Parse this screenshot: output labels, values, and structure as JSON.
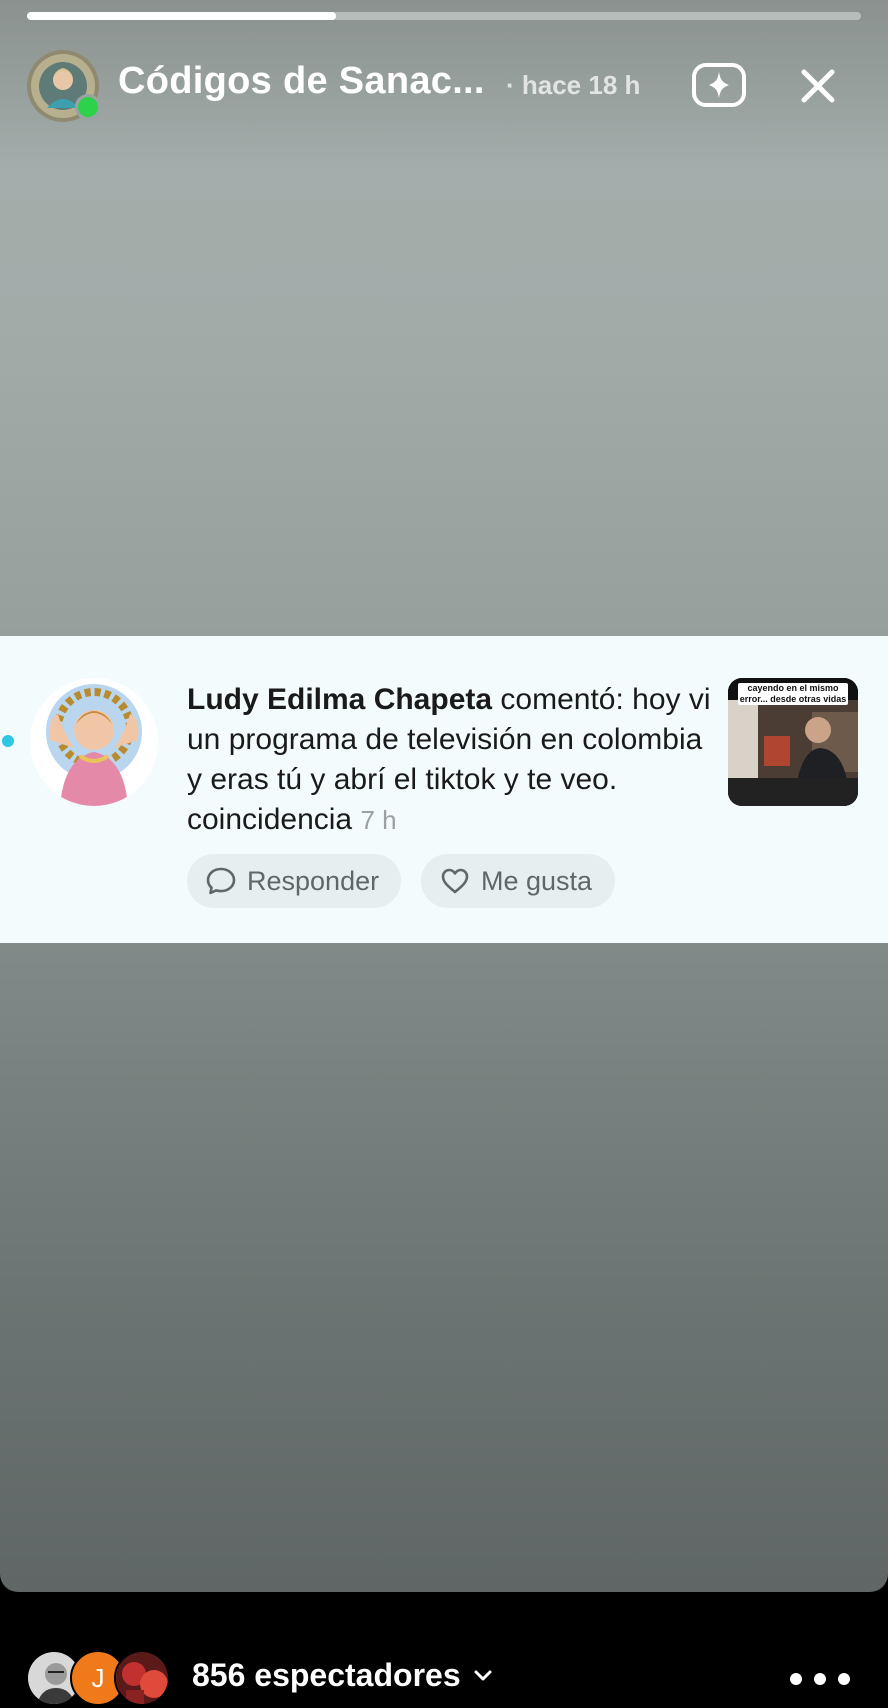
{
  "story": {
    "progress": 0.37,
    "account_name": "Códigos de Sanac...",
    "time_ago": "· hace 18 h",
    "icons": {
      "add_effect": "sparkle-square-icon",
      "close": "close-icon"
    }
  },
  "notification": {
    "username": "Ludy Edilma Chapeta",
    "action": " comentó:",
    "comment": "hoy vi un programa de televisión en colombia y eras tú y abrí el tiktok y te veo. coincidencia",
    "time": "7 h",
    "thumbnail_caption": "cayendo en el mismo error... desde otras vidas",
    "reply_label": "Responder",
    "like_label": "Me gusta"
  },
  "footer": {
    "viewer_initial": "J",
    "viewers_label": "856 espectadores"
  },
  "colors": {
    "live": "#2bd24a",
    "unread": "#2ec7e3",
    "notification_bg": "#f3fbfd"
  }
}
